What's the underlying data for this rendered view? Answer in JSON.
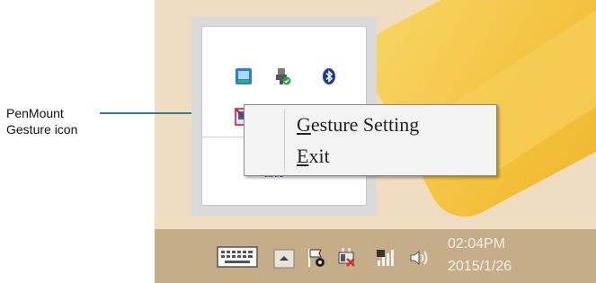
{
  "callout": {
    "line1": "PenMount",
    "line2": "Gesture icon"
  },
  "tray_popup": {
    "icons": [
      "app-icon",
      "usb-device-icon",
      "bluetooth-icon",
      "penmount-gesture-icon",
      "display-icon"
    ],
    "customize_link": "自訂..."
  },
  "context_menu": {
    "items": [
      {
        "mnemonic": "G",
        "rest": "esture Setting"
      },
      {
        "mnemonic": "E",
        "rest": "xit"
      }
    ]
  },
  "taskbar": {
    "icons": [
      "keyboard-icon",
      "show-hidden-icons-chevron",
      "action-center-flag-icon",
      "power-icon",
      "network-signal-icon",
      "volume-icon"
    ],
    "clock_time": "02:04PM",
    "clock_date": "2015/1/26"
  },
  "colors": {
    "desktop": "#f0dcc0",
    "taskbar": "#c5ad89",
    "callout_line": "#2f8090",
    "menu_bg": "#f3f3f3"
  }
}
